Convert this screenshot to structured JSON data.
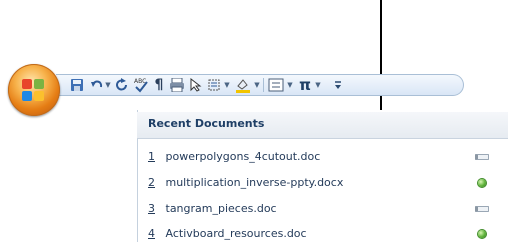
{
  "quick_access_toolbar": {
    "buttons": [
      {
        "name": "save",
        "glyph": "💾"
      },
      {
        "name": "undo",
        "glyph": "↶"
      },
      {
        "name": "redo",
        "glyph": "↻"
      },
      {
        "name": "spelling",
        "glyph": "ABC✓"
      },
      {
        "name": "paragraph-mark",
        "glyph": "¶"
      },
      {
        "name": "print",
        "glyph": "🖶"
      },
      {
        "name": "select-pointer",
        "glyph": "↖"
      },
      {
        "name": "text-box",
        "glyph": "⌗"
      },
      {
        "name": "highlighter",
        "glyph": "✎"
      },
      {
        "name": "shading",
        "glyph": "▤"
      },
      {
        "name": "equation",
        "glyph": "π"
      },
      {
        "name": "customize",
        "glyph": "⩢"
      }
    ]
  },
  "recent_documents": {
    "title": "Recent Documents",
    "items": [
      {
        "number": "1",
        "name": "powerpolygons_4cutout.doc",
        "pinned": false
      },
      {
        "number": "2",
        "name": "multiplication_inverse-ppty.docx",
        "pinned": true
      },
      {
        "number": "3",
        "name": "tangram_pieces.doc",
        "pinned": false
      },
      {
        "number": "4",
        "name": "Activboard_resources.doc",
        "pinned": true
      }
    ]
  }
}
